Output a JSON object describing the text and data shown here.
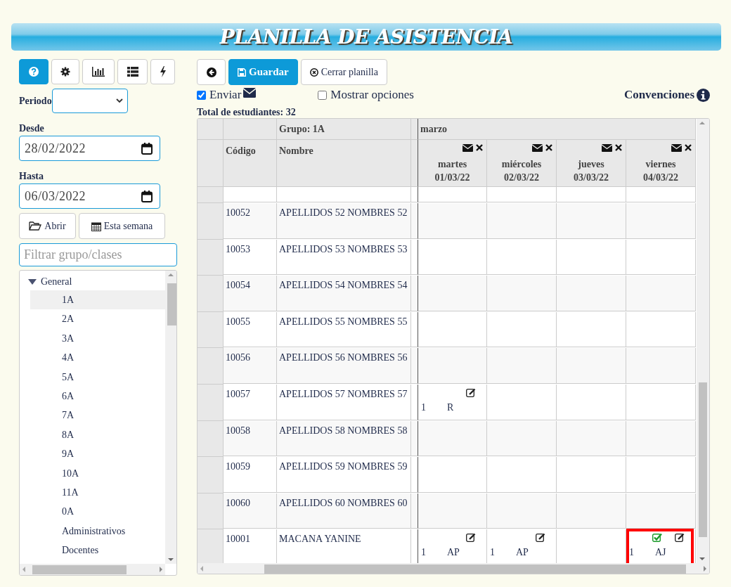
{
  "title": "PLANILLA DE ASISTENCIA",
  "sidebar_toolbar": [
    {
      "kind": "help",
      "selected": true
    },
    {
      "kind": "gear",
      "selected": false
    },
    {
      "kind": "chart",
      "selected": false
    },
    {
      "kind": "list",
      "selected": false
    },
    {
      "kind": "bolt",
      "selected": false
    }
  ],
  "periodo": {
    "label": "Periodo"
  },
  "desde": {
    "label": "Desde",
    "value": "28/02/2022"
  },
  "hasta": {
    "label": "Hasta",
    "value": "06/03/2022"
  },
  "sidebar_buttons": [
    {
      "kind": "folder",
      "label": "Abrir"
    },
    {
      "kind": "calendar",
      "label": "Esta semana"
    }
  ],
  "filter": {
    "placeholder": "Filtrar grupo/clases"
  },
  "tree": [
    {
      "label": "General",
      "expanded": true,
      "children": [
        {
          "label": "1A",
          "selected": true
        },
        {
          "label": "2A",
          "selected": false
        },
        {
          "label": "3A",
          "selected": false
        },
        {
          "label": "4A",
          "selected": false
        },
        {
          "label": "5A",
          "selected": false
        },
        {
          "label": "6A",
          "selected": false
        },
        {
          "label": "7A",
          "selected": false
        },
        {
          "label": "8A",
          "selected": false
        },
        {
          "label": "9A",
          "selected": false
        },
        {
          "label": "10A",
          "selected": false
        },
        {
          "label": "11A",
          "selected": false
        },
        {
          "label": "0A",
          "selected": false
        },
        {
          "label": "Administrativos",
          "selected": false
        },
        {
          "label": "Docentes",
          "selected": false
        }
      ]
    }
  ],
  "toolbar": [
    {
      "kind": "icon"
    },
    {
      "label": "Guardar",
      "kind": "primary"
    },
    {
      "label": "Cerrar planilla",
      "kind": "default"
    }
  ],
  "enviar": {
    "label": "Enviar",
    "checked": true
  },
  "mostrar_opciones": {
    "label": "Mostrar opciones",
    "checked": false
  },
  "convenciones": "Convenciones",
  "total": "Total de estudiantes: 32",
  "table": {
    "group": "Grupo: 1A",
    "month": "marzo",
    "code_header": "Código",
    "name_header": "Nombre",
    "days": [
      {
        "weekday": "martes",
        "date": "01/03/22"
      },
      {
        "weekday": "miércoles",
        "date": "02/03/22"
      },
      {
        "weekday": "jueves",
        "date": "03/03/22"
      },
      {
        "weekday": "viernes",
        "date": "04/03/22"
      }
    ],
    "rows": [
      {
        "code": "10052",
        "name": "APELLIDOS 52 NOMBRES 52",
        "cells": [
          {
            "kind": "empty"
          },
          {
            "kind": "empty"
          },
          {
            "kind": "empty"
          },
          {
            "kind": "empty"
          }
        ]
      },
      {
        "code": "10053",
        "name": "APELLIDOS 53 NOMBRES 53",
        "cells": [
          {
            "kind": "empty"
          },
          {
            "kind": "empty"
          },
          {
            "kind": "empty"
          },
          {
            "kind": "empty"
          }
        ]
      },
      {
        "code": "10054",
        "name": "APELLIDOS 54 NOMBRES 54",
        "cells": [
          {
            "kind": "empty"
          },
          {
            "kind": "empty"
          },
          {
            "kind": "empty"
          },
          {
            "kind": "empty"
          }
        ]
      },
      {
        "code": "10055",
        "name": "APELLIDOS 55 NOMBRES 55",
        "cells": [
          {
            "kind": "empty"
          },
          {
            "kind": "empty"
          },
          {
            "kind": "empty"
          },
          {
            "kind": "empty"
          }
        ]
      },
      {
        "code": "10056",
        "name": "APELLIDOS 56 NOMBRES 56",
        "cells": [
          {
            "kind": "empty"
          },
          {
            "kind": "empty"
          },
          {
            "kind": "empty"
          },
          {
            "kind": "empty"
          }
        ]
      },
      {
        "code": "10057",
        "name": "APELLIDOS 57 NOMBRES 57",
        "cells": [
          {
            "kind": "mark",
            "count": "1",
            "code": "R",
            "approved": false,
            "highlighted": false
          },
          {
            "kind": "empty"
          },
          {
            "kind": "empty"
          },
          {
            "kind": "empty"
          }
        ]
      },
      {
        "code": "10058",
        "name": "APELLIDOS 58 NOMBRES 58",
        "cells": [
          {
            "kind": "empty"
          },
          {
            "kind": "empty"
          },
          {
            "kind": "empty"
          },
          {
            "kind": "empty"
          }
        ]
      },
      {
        "code": "10059",
        "name": "APELLIDOS 59 NOMBRES 59",
        "cells": [
          {
            "kind": "empty"
          },
          {
            "kind": "empty"
          },
          {
            "kind": "empty"
          },
          {
            "kind": "empty"
          }
        ]
      },
      {
        "code": "10060",
        "name": "APELLIDOS 60 NOMBRES 60",
        "cells": [
          {
            "kind": "empty"
          },
          {
            "kind": "empty"
          },
          {
            "kind": "empty"
          },
          {
            "kind": "empty"
          }
        ]
      },
      {
        "code": "10001",
        "name": "MACANA YANINE",
        "cells": [
          {
            "kind": "mark",
            "count": "1",
            "code": "AP",
            "approved": false,
            "highlighted": false
          },
          {
            "kind": "mark",
            "count": "1",
            "code": "AP",
            "approved": false,
            "highlighted": false
          },
          {
            "kind": "empty"
          },
          {
            "kind": "mark",
            "count": "1",
            "code": "AJ",
            "approved": true,
            "highlighted": true
          }
        ]
      }
    ]
  }
}
